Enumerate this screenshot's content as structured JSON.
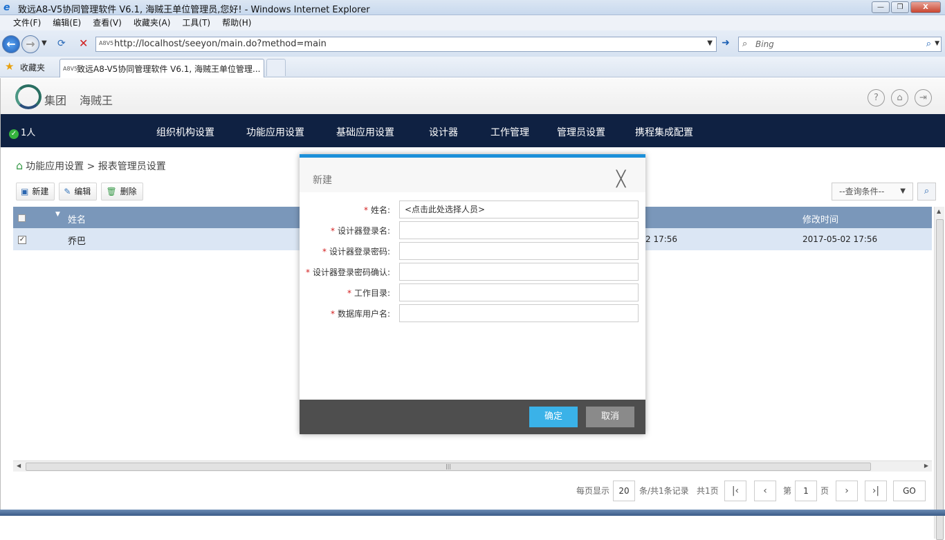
{
  "window": {
    "title": "致远A8-V5协同管理软件 V6.1, 海贼王单位管理员,您好! - Windows Internet Explorer",
    "minimize_icon": "—",
    "restore_icon": "❐",
    "close_icon": "X"
  },
  "menu": [
    "文件(F)",
    "编辑(E)",
    "查看(V)",
    "收藏夹(A)",
    "工具(T)",
    "帮助(H)"
  ],
  "address": {
    "url": "http://localhost/seeyon/main.do?method=main",
    "search_placeholder": "Bing"
  },
  "favorites": {
    "label": "收藏夹",
    "tab_title": "致远A8-V5协同管理软件 V6.1, 海贼王单位管理..."
  },
  "app": {
    "brand_group": "集团",
    "brand_unit": "海贼王",
    "online_count": "1人",
    "nav": [
      "组织机构设置",
      "功能应用设置",
      "基础应用设置",
      "设计器",
      "工作管理",
      "管理员设置",
      "携程集成配置"
    ],
    "breadcrumb": "功能应用设置 > 报表管理员设置",
    "toolbar": {
      "new": "新建",
      "edit": "编辑",
      "delete": "删除"
    },
    "query_select": "--查询条件--",
    "table": {
      "col_name": "姓名",
      "col_modified": "修改时间",
      "rows": [
        {
          "name": "乔巴",
          "partial_time": "2 17:56",
          "modified": "2017-05-02 17:56"
        }
      ]
    },
    "pager": {
      "per_page_label": "每页显示",
      "per_page": "20",
      "summary": "条/共1条记录",
      "pages": "共1页",
      "page_prefix": "第",
      "page": "1",
      "page_suffix": "页",
      "go": "GO"
    }
  },
  "dialog": {
    "title": "新建",
    "fields": [
      {
        "label": "姓名:",
        "value": "<点击此处选择人员>"
      },
      {
        "label": "设计器登录名:",
        "value": ""
      },
      {
        "label": "设计器登录密码:",
        "value": ""
      },
      {
        "label": "设计器登录密码确认:",
        "value": ""
      },
      {
        "label": "工作目录:",
        "value": ""
      },
      {
        "label": "数据库用户名:",
        "value": ""
      }
    ],
    "ok": "确定",
    "cancel": "取消"
  },
  "colors": {
    "nav_bg": "#0f2142",
    "header_bg": "#7a97ba",
    "ok_btn": "#3ab2e8",
    "accent": "#1c90d9"
  }
}
